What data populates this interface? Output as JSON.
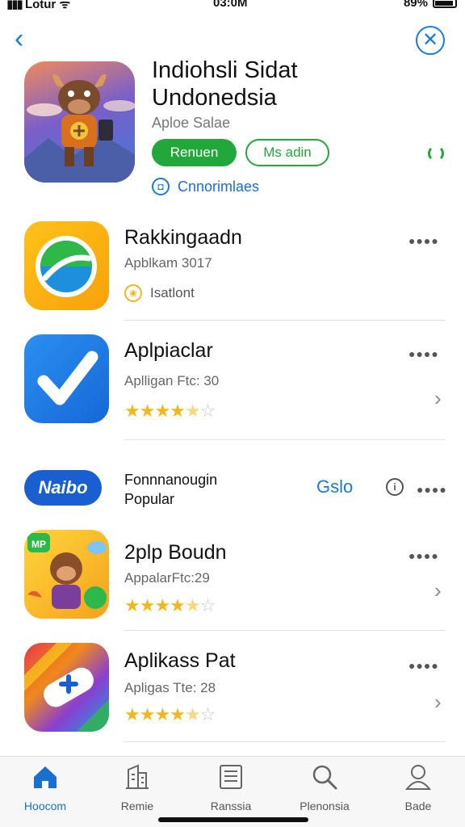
{
  "status_bar": {
    "carrier": "Lotur",
    "time": "03:0M",
    "battery": "89%"
  },
  "nav": {
    "back": "‹",
    "close": "✕"
  },
  "hero": {
    "title_line1": "Indiohsli Sidat",
    "title_line2": "Undonedsia",
    "subtitle": "Aploe Salae",
    "primary_button": "Renuen",
    "secondary_button": "Ms adin",
    "link_label": "Cnnorimlaes"
  },
  "items": [
    {
      "title": "Rakkingaadn",
      "subtitle": "Apblkam 3017",
      "badge": "Isatlont"
    },
    {
      "title": "Aplpiaclar",
      "subtitle": "Aplligan Ftc: 30",
      "rating": 4.5
    },
    {
      "title": "2plp Boudn",
      "subtitle": "AppalarFtc:29",
      "rating": 4.5
    },
    {
      "title": "Aplikass Pat",
      "subtitle": "Apligas Tte: 28",
      "rating": 4.5
    }
  ],
  "popular": {
    "logo_text": "Naibo",
    "line1": "Fonnnanougin",
    "line2": "Popular",
    "get_label": "Gslo"
  },
  "tabs": [
    {
      "label": "Hoocom",
      "icon": "home-icon"
    },
    {
      "label": "Remie",
      "icon": "building-icon"
    },
    {
      "label": "Ranssia",
      "icon": "list-icon"
    },
    {
      "label": "Plenonsia",
      "icon": "search-icon"
    },
    {
      "label": "Bade",
      "icon": "person-icon"
    }
  ],
  "colors": {
    "accent": "#1a7ad9",
    "green": "#22a83a",
    "star": "#f2b71c"
  }
}
